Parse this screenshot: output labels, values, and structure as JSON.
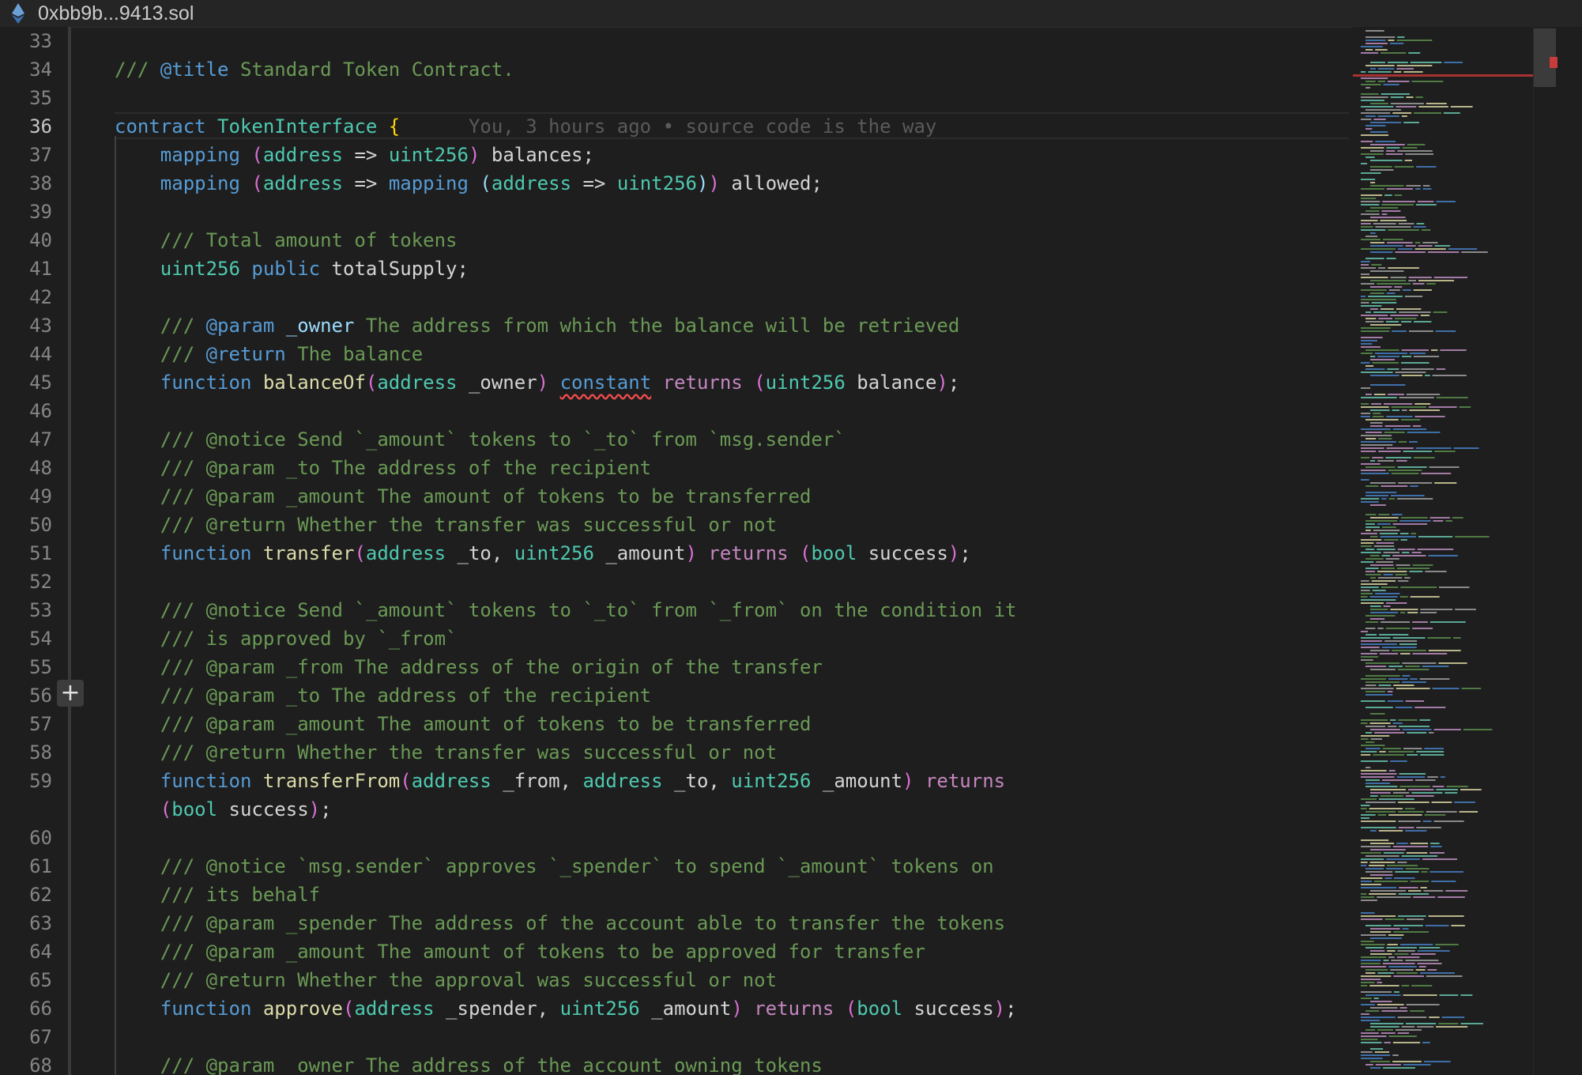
{
  "window": {
    "title": "0xbb9b...9413.sol",
    "file_icon": "ethereum-icon"
  },
  "editor": {
    "active_line": "36",
    "blame": "You, 3 hours ago • source code is the way",
    "gutter_action": "+"
  },
  "lines": [
    {
      "n": "33",
      "t": []
    },
    {
      "n": "34",
      "t": [
        [
          "cm",
          "/// "
        ],
        [
          "tag",
          "@title"
        ],
        [
          "cm",
          " Standard Token Contract."
        ]
      ]
    },
    {
      "n": "35",
      "t": []
    },
    {
      "n": "36",
      "t": [
        [
          "kw",
          "contract"
        ],
        [
          "p",
          " "
        ],
        [
          "ty",
          "TokenInterface"
        ],
        [
          "p",
          " "
        ],
        [
          "br",
          "{"
        ]
      ]
    },
    {
      "n": "37",
      "t": [
        [
          "p",
          "    "
        ],
        [
          "kw",
          "mapping"
        ],
        [
          "p",
          " "
        ],
        [
          "bp",
          "("
        ],
        [
          "ty",
          "address"
        ],
        [
          "p",
          " => "
        ],
        [
          "ty",
          "uint256"
        ],
        [
          "bp",
          ")"
        ],
        [
          "p",
          " balances;"
        ]
      ]
    },
    {
      "n": "38",
      "t": [
        [
          "p",
          "    "
        ],
        [
          "kw",
          "mapping"
        ],
        [
          "p",
          " "
        ],
        [
          "bp",
          "("
        ],
        [
          "ty",
          "address"
        ],
        [
          "p",
          " => "
        ],
        [
          "kw",
          "mapping"
        ],
        [
          "p",
          " "
        ],
        [
          "par",
          "("
        ],
        [
          "ty",
          "address"
        ],
        [
          "p",
          " => "
        ],
        [
          "ty",
          "uint256"
        ],
        [
          "par",
          ")"
        ],
        [
          "bp",
          ")"
        ],
        [
          "p",
          " allowed;"
        ]
      ]
    },
    {
      "n": "39",
      "t": []
    },
    {
      "n": "40",
      "t": [
        [
          "p",
          "    "
        ],
        [
          "cm",
          "/// Total amount of tokens"
        ]
      ]
    },
    {
      "n": "41",
      "t": [
        [
          "p",
          "    "
        ],
        [
          "ty",
          "uint256"
        ],
        [
          "p",
          " "
        ],
        [
          "kw",
          "public"
        ],
        [
          "p",
          " totalSupply;"
        ]
      ]
    },
    {
      "n": "42",
      "t": []
    },
    {
      "n": "43",
      "t": [
        [
          "p",
          "    "
        ],
        [
          "cm",
          "/// "
        ],
        [
          "tag",
          "@param"
        ],
        [
          "p",
          " "
        ],
        [
          "par",
          "_owner"
        ],
        [
          "cm",
          " The address from which the balance will be retrieved"
        ]
      ]
    },
    {
      "n": "44",
      "t": [
        [
          "p",
          "    "
        ],
        [
          "cm",
          "/// "
        ],
        [
          "tag",
          "@return"
        ],
        [
          "cm",
          " The balance"
        ]
      ]
    },
    {
      "n": "45",
      "t": [
        [
          "p",
          "    "
        ],
        [
          "kw",
          "function"
        ],
        [
          "p",
          " "
        ],
        [
          "fn",
          "balanceOf"
        ],
        [
          "bp",
          "("
        ],
        [
          "ty",
          "address"
        ],
        [
          "p",
          " _owner"
        ],
        [
          "bp",
          ")"
        ],
        [
          "p",
          " "
        ],
        [
          "sq",
          "constant"
        ],
        [
          "p",
          " "
        ],
        [
          "kw2",
          "returns"
        ],
        [
          "p",
          " "
        ],
        [
          "bp",
          "("
        ],
        [
          "ty",
          "uint256"
        ],
        [
          "p",
          " balance"
        ],
        [
          "bp",
          ")"
        ],
        [
          "p",
          ";"
        ]
      ]
    },
    {
      "n": "46",
      "t": []
    },
    {
      "n": "47",
      "t": [
        [
          "p",
          "    "
        ],
        [
          "cm",
          "/// @notice Send `_amount` tokens to `_to` from `msg.sender`"
        ]
      ]
    },
    {
      "n": "48",
      "t": [
        [
          "p",
          "    "
        ],
        [
          "cm",
          "/// @param _to The address of the recipient"
        ]
      ]
    },
    {
      "n": "49",
      "t": [
        [
          "p",
          "    "
        ],
        [
          "cm",
          "/// @param _amount The amount of tokens to be transferred"
        ]
      ]
    },
    {
      "n": "50",
      "t": [
        [
          "p",
          "    "
        ],
        [
          "cm",
          "/// @return Whether the transfer was successful or not"
        ]
      ]
    },
    {
      "n": "51",
      "t": [
        [
          "p",
          "    "
        ],
        [
          "kw",
          "function"
        ],
        [
          "p",
          " "
        ],
        [
          "fn",
          "transfer"
        ],
        [
          "bp",
          "("
        ],
        [
          "ty",
          "address"
        ],
        [
          "p",
          " _to, "
        ],
        [
          "ty",
          "uint256"
        ],
        [
          "p",
          " _amount"
        ],
        [
          "bp",
          ")"
        ],
        [
          "p",
          " "
        ],
        [
          "kw2",
          "returns"
        ],
        [
          "p",
          " "
        ],
        [
          "bp",
          "("
        ],
        [
          "ty",
          "bool"
        ],
        [
          "p",
          " success"
        ],
        [
          "bp",
          ")"
        ],
        [
          "p",
          ";"
        ]
      ]
    },
    {
      "n": "52",
      "t": []
    },
    {
      "n": "53",
      "t": [
        [
          "p",
          "    "
        ],
        [
          "cm",
          "/// @notice Send `_amount` tokens to `_to` from `_from` on the condition it"
        ]
      ]
    },
    {
      "n": "54",
      "t": [
        [
          "p",
          "    "
        ],
        [
          "cm",
          "/// is approved by `_from`"
        ]
      ]
    },
    {
      "n": "55",
      "t": [
        [
          "p",
          "    "
        ],
        [
          "cm",
          "/// @param _from The address of the origin of the transfer"
        ]
      ]
    },
    {
      "n": "56",
      "t": [
        [
          "p",
          "    "
        ],
        [
          "cm",
          "/// @param _to The address of the recipient"
        ]
      ]
    },
    {
      "n": "57",
      "t": [
        [
          "p",
          "    "
        ],
        [
          "cm",
          "/// @param _amount The amount of tokens to be transferred"
        ]
      ]
    },
    {
      "n": "58",
      "t": [
        [
          "p",
          "    "
        ],
        [
          "cm",
          "/// @return Whether the transfer was successful or not"
        ]
      ]
    },
    {
      "n": "59",
      "t": [
        [
          "p",
          "    "
        ],
        [
          "kw",
          "function"
        ],
        [
          "p",
          " "
        ],
        [
          "fn",
          "transferFrom"
        ],
        [
          "bp",
          "("
        ],
        [
          "ty",
          "address"
        ],
        [
          "p",
          " _from, "
        ],
        [
          "ty",
          "address"
        ],
        [
          "p",
          " _to, "
        ],
        [
          "ty",
          "uint256"
        ],
        [
          "p",
          " _amount"
        ],
        [
          "bp",
          ")"
        ],
        [
          "p",
          " "
        ],
        [
          "kw2",
          "returns"
        ]
      ]
    },
    {
      "n": "",
      "t": [
        [
          "p",
          "    "
        ],
        [
          "bp",
          "("
        ],
        [
          "ty",
          "bool"
        ],
        [
          "p",
          " success"
        ],
        [
          "bp",
          ")"
        ],
        [
          "p",
          ";"
        ]
      ]
    },
    {
      "n": "60",
      "t": []
    },
    {
      "n": "61",
      "t": [
        [
          "p",
          "    "
        ],
        [
          "cm",
          "/// @notice `msg.sender` approves `_spender` to spend `_amount` tokens on"
        ]
      ]
    },
    {
      "n": "62",
      "t": [
        [
          "p",
          "    "
        ],
        [
          "cm",
          "/// its behalf"
        ]
      ]
    },
    {
      "n": "63",
      "t": [
        [
          "p",
          "    "
        ],
        [
          "cm",
          "/// @param _spender The address of the account able to transfer the tokens"
        ]
      ]
    },
    {
      "n": "64",
      "t": [
        [
          "p",
          "    "
        ],
        [
          "cm",
          "/// @param _amount The amount of tokens to be approved for transfer"
        ]
      ]
    },
    {
      "n": "65",
      "t": [
        [
          "p",
          "    "
        ],
        [
          "cm",
          "/// @return Whether the approval was successful or not"
        ]
      ]
    },
    {
      "n": "66",
      "t": [
        [
          "p",
          "    "
        ],
        [
          "kw",
          "function"
        ],
        [
          "p",
          " "
        ],
        [
          "fn",
          "approve"
        ],
        [
          "bp",
          "("
        ],
        [
          "ty",
          "address"
        ],
        [
          "p",
          " _spender, "
        ],
        [
          "ty",
          "uint256"
        ],
        [
          "p",
          " _amount"
        ],
        [
          "bp",
          ")"
        ],
        [
          "p",
          " "
        ],
        [
          "kw2",
          "returns"
        ],
        [
          "p",
          " "
        ],
        [
          "bp",
          "("
        ],
        [
          "ty",
          "bool"
        ],
        [
          "p",
          " success"
        ],
        [
          "bp",
          ")"
        ],
        [
          "p",
          ";"
        ]
      ]
    },
    {
      "n": "67",
      "t": []
    },
    {
      "n": "68",
      "t": [
        [
          "p",
          "    "
        ],
        [
          "cm",
          "/// @param _owner The address of the account owning tokens"
        ]
      ]
    }
  ]
}
